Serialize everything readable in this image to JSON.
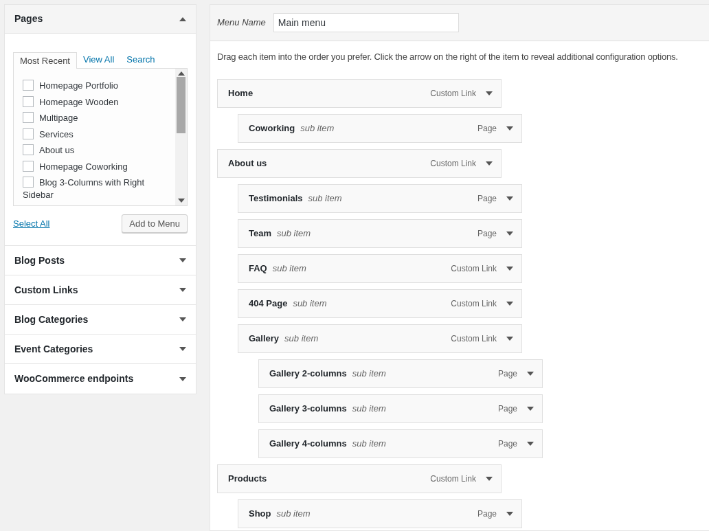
{
  "sidebar": {
    "pages": {
      "title": "Pages",
      "expanded": true,
      "tabs": [
        {
          "label": "Most Recent",
          "selected": true
        },
        {
          "label": "View All",
          "selected": false
        },
        {
          "label": "Search",
          "selected": false
        }
      ],
      "items": [
        {
          "label": "Homepage Portfolio",
          "checked": false
        },
        {
          "label": "Homepage Wooden",
          "checked": false
        },
        {
          "label": "Multipage",
          "checked": false
        },
        {
          "label": "Services",
          "checked": false
        },
        {
          "label": "About us",
          "checked": false
        },
        {
          "label": "Homepage Coworking",
          "checked": false
        },
        {
          "label": "Blog 3-Columns with Right Sidebar",
          "checked": false
        }
      ],
      "select_all": "Select All",
      "add_button": "Add to Menu"
    },
    "sections": [
      {
        "title": "Blog Posts",
        "expanded": false
      },
      {
        "title": "Custom Links",
        "expanded": false
      },
      {
        "title": "Blog Categories",
        "expanded": false
      },
      {
        "title": "Event Categories",
        "expanded": false
      },
      {
        "title": "WooCommerce endpoints",
        "expanded": false
      }
    ]
  },
  "menu": {
    "name_label": "Menu Name",
    "name_value": "Main menu",
    "instructions": "Drag each item into the order you prefer. Click the arrow on the right of the item to reveal additional configuration options.",
    "items": [
      {
        "title": "Home",
        "type": "Custom Link",
        "children": [
          {
            "title": "Coworking",
            "note": "sub item",
            "type": "Page"
          }
        ]
      },
      {
        "title": "About us",
        "type": "Custom Link",
        "children": [
          {
            "title": "Testimonials",
            "note": "sub item",
            "type": "Page"
          },
          {
            "title": "Team",
            "note": "sub item",
            "type": "Page"
          },
          {
            "title": "FAQ",
            "note": "sub item",
            "type": "Custom Link"
          },
          {
            "title": "404 Page",
            "note": "sub item",
            "type": "Custom Link"
          },
          {
            "title": "Gallery",
            "note": "sub item",
            "type": "Custom Link",
            "children": [
              {
                "title": "Gallery 2-columns",
                "note": "sub item",
                "type": "Page"
              },
              {
                "title": "Gallery 3-columns",
                "note": "sub item",
                "type": "Page"
              },
              {
                "title": "Gallery 4-columns",
                "note": "sub item",
                "type": "Page"
              }
            ]
          }
        ]
      },
      {
        "title": "Products",
        "type": "Custom Link",
        "children": [
          {
            "title": "Shop",
            "note": "sub item",
            "type": "Page"
          }
        ]
      }
    ]
  }
}
